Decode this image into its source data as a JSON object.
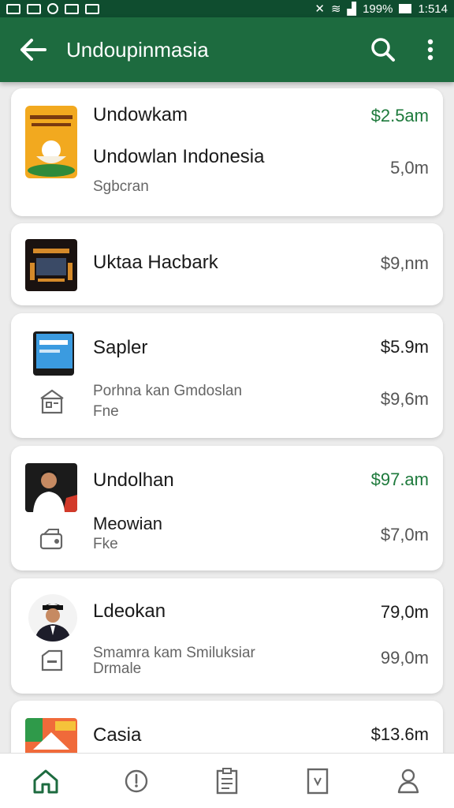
{
  "statusbar": {
    "battery": "199%",
    "time": "1:514"
  },
  "header": {
    "title": "Undoupinmasia",
    "back_icon": "back-arrow-icon",
    "search_icon": "search-icon",
    "menu_icon": "more-vertical-icon"
  },
  "accent": "#1d6b3f",
  "items": [
    {
      "name": "Undowkam",
      "price": "$2.5am",
      "name2": "Undowlan Indonesia",
      "price2": "5,0m",
      "sub": "Sgbcran"
    },
    {
      "name": "Uktaa Hacbark",
      "price": "$9,nm"
    },
    {
      "name": "Sapler",
      "price": "$5.9m",
      "name2": "Porhna kan Gmdoslan",
      "price2": "$9,6m",
      "sub": "Fne"
    },
    {
      "name": "Undolhan",
      "price": "$97.am",
      "name2": "Meowian",
      "price2": "$7,0m",
      "sub": "Fke"
    },
    {
      "name": "Ldeokan",
      "price": "79,0m",
      "name2": "Smamra kam Smiluksiar",
      "price2": "99,0m",
      "sub": "Drmale"
    },
    {
      "name": "Casia",
      "price": "$13.6m"
    }
  ],
  "nav": [
    "home-icon",
    "compass-icon",
    "clipboard-icon",
    "book-icon",
    "profile-icon"
  ]
}
